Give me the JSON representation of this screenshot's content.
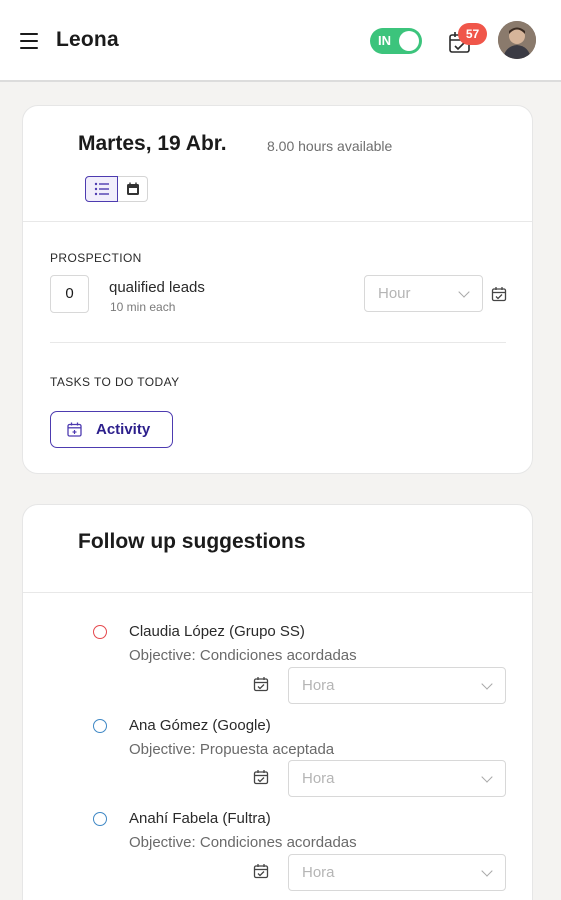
{
  "header": {
    "title": "Leona",
    "status_toggle_label": "IN",
    "notification_count": "57",
    "colors": {
      "toggle_on": "#3cc47c",
      "badge": "#f0564a",
      "accent": "#4d3bb0"
    }
  },
  "day_card": {
    "date": "Martes, 19 Abr.",
    "hours_available": "8.00 hours available",
    "view_options": [
      "list-icon",
      "calendar-icon"
    ],
    "prospection": {
      "label": "PROSPECTION",
      "count": "0",
      "leads_label": "qualified leads",
      "leads_sub": "10 min each",
      "hour_placeholder": "Hour"
    },
    "tasks": {
      "label": "TASKS TO DO TODAY",
      "activity_button": "Activity"
    }
  },
  "follow_up": {
    "title": "Follow up suggestions",
    "items": [
      {
        "name": "Claudia López (Grupo SS)",
        "objective": "Objective: Condiciones acordadas",
        "hour_placeholder": "Hora",
        "status_color": "#e5484d"
      },
      {
        "name": "Ana Gómez (Google)",
        "objective": "Objective: Propuesta aceptada",
        "hour_placeholder": "Hora",
        "status_color": "#3f88c5"
      },
      {
        "name": "Anahí Fabela (Fultra)",
        "objective": "Objective: Condiciones acordadas",
        "hour_placeholder": "Hora",
        "status_color": "#3f88c5"
      }
    ]
  }
}
